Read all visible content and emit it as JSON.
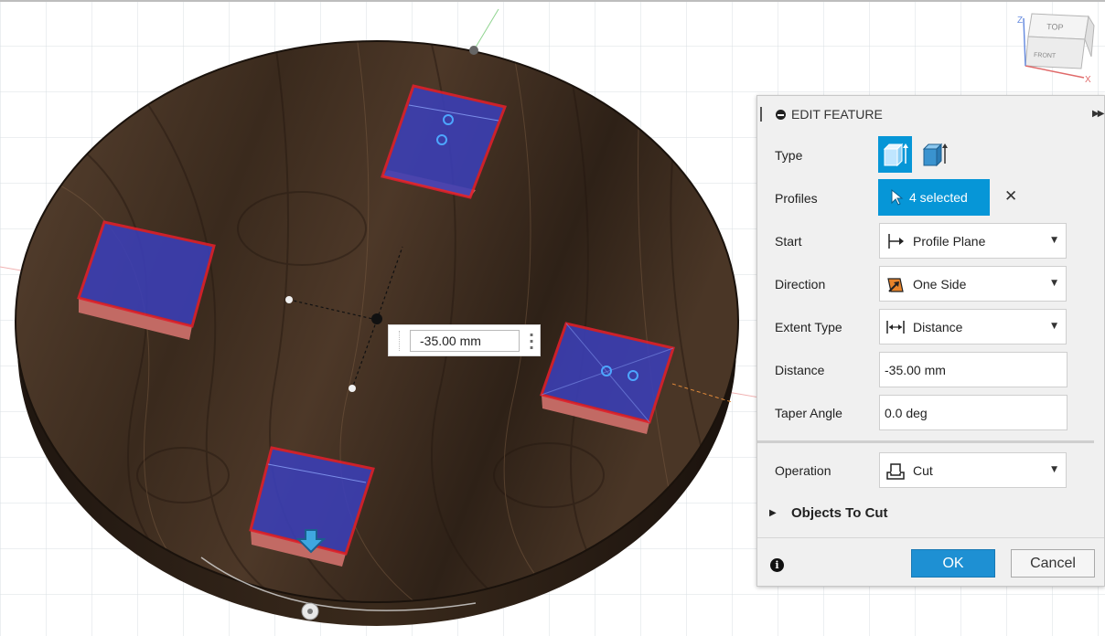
{
  "viewcube": {
    "top_label": "TOP",
    "front_label": "FRONT",
    "axis_x": "X",
    "axis_z": "Z"
  },
  "dimension_input": {
    "value": "-35.00 mm"
  },
  "panel": {
    "title": "EDIT FEATURE",
    "type_label": "Type",
    "profiles_label": "Profiles",
    "profiles_value": "4 selected",
    "start_label": "Start",
    "start_value": "Profile Plane",
    "direction_label": "Direction",
    "direction_value": "One Side",
    "extent_label": "Extent Type",
    "extent_value": "Distance",
    "distance_label": "Distance",
    "distance_value": "-35.00 mm",
    "taper_label": "Taper Angle",
    "taper_value": "0.0 deg",
    "operation_label": "Operation",
    "operation_value": "Cut",
    "objects_to_cut": "Objects To Cut",
    "ok_label": "OK",
    "cancel_label": "Cancel"
  },
  "colors": {
    "accent": "#0696d7",
    "profile_fill": "#3b3fb8",
    "profile_edge": "#e0202c",
    "wood": "#3c2b1e"
  }
}
